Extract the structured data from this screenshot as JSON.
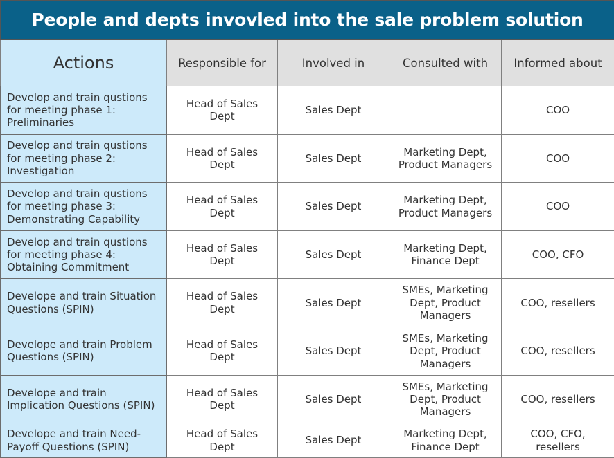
{
  "title": "People and depts invovled into the sale problem solution",
  "colors": {
    "banner_bg": "#0A6189",
    "banner_text": "#FFFFFF",
    "header_bg": "#E0E0E0",
    "actions_bg": "#CDEAFA",
    "cell_bg": "#FFFFFF",
    "border": "#808080",
    "text": "#333333"
  },
  "columns": [
    {
      "key": "action",
      "label": "Actions"
    },
    {
      "key": "responsible",
      "label": "Responsible for"
    },
    {
      "key": "involved",
      "label": "Involved in"
    },
    {
      "key": "consulted",
      "label": "Consulted with"
    },
    {
      "key": "informed",
      "label": "Informed about"
    }
  ],
  "rows": [
    {
      "action": "Develop and train qustions for meeting phase 1: Preliminaries",
      "responsible": "Head of Sales Dept",
      "involved": "Sales Dept",
      "consulted": "",
      "informed": "COO"
    },
    {
      "action": "Develop and train qustions for meeting phase 2: Investigation",
      "responsible": "Head of Sales Dept",
      "involved": "Sales Dept",
      "consulted": "Marketing Dept, Product Managers",
      "informed": "COO"
    },
    {
      "action": "Develop and train qustions for meeting phase 3: Demonstrating Capability",
      "responsible": "Head of Sales Dept",
      "involved": "Sales Dept",
      "consulted": "Marketing Dept, Product Managers",
      "informed": "COO"
    },
    {
      "action": "Develop and train qustions for meeting phase 4: Obtaining Commitment",
      "responsible": "Head of Sales Dept",
      "involved": "Sales Dept",
      "consulted": "Marketing Dept, Finance Dept",
      "informed": "COO, CFO"
    },
    {
      "action": "Develope and train Situation Questions (SPIN)",
      "responsible": "Head of Sales Dept",
      "involved": "Sales Dept",
      "consulted": "SMEs, Marketing Dept, Product Managers",
      "informed": "COO, resellers"
    },
    {
      "action": "Develope and train Problem Questions (SPIN)",
      "responsible": "Head of Sales Dept",
      "involved": "Sales Dept",
      "consulted": "SMEs, Marketing Dept, Product Managers",
      "informed": "COO, resellers"
    },
    {
      "action": "Develope and train Implication Questions (SPIN)",
      "responsible": "Head of Sales Dept",
      "involved": "Sales Dept",
      "consulted": "SMEs, Marketing Dept, Product Managers",
      "informed": "COO, resellers"
    },
    {
      "action": "Develope and train Need-Payoff Questions (SPIN)",
      "responsible": "Head of Sales Dept",
      "involved": "Sales Dept",
      "consulted": "Marketing Dept, Finance Dept",
      "informed": "COO, CFO, resellers"
    }
  ]
}
